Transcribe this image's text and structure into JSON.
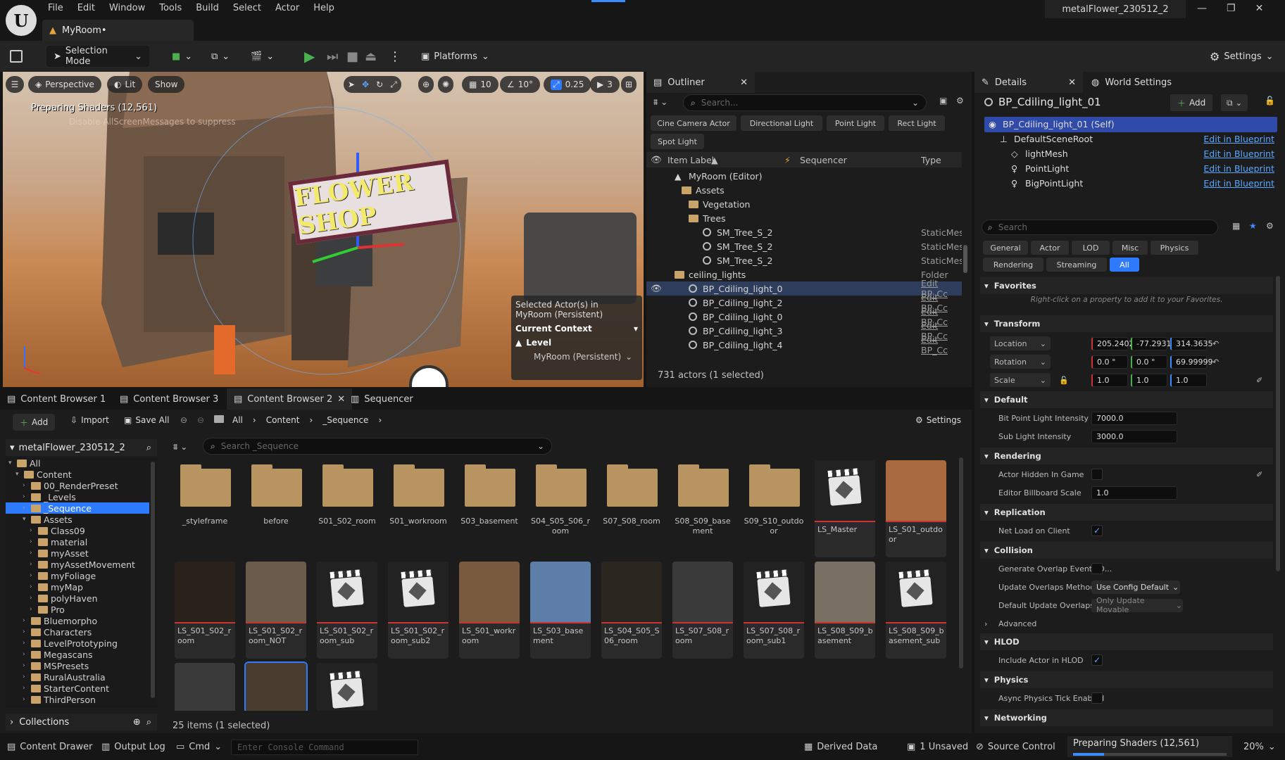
{
  "app": {
    "logo": "U",
    "project_title": "metalFlower_230512_2",
    "level_tab": "MyRoom•"
  },
  "menu": [
    "File",
    "Edit",
    "Window",
    "Tools",
    "Build",
    "Select",
    "Actor",
    "Help"
  ],
  "toolbar": {
    "selection_mode": "Selection Mode",
    "platforms": "Platforms",
    "settings": "Settings"
  },
  "viewport": {
    "perspective": "Perspective",
    "lit": "Lit",
    "show": "Show",
    "grid_value": "10",
    "angle_value": "10°",
    "scale_value": "0.25",
    "camera_speed": "3",
    "shader_msg": "Preparing Shaders (12,561)",
    "shader_sub": "Disable AllScreenMessages to suppress",
    "selected_label": "Selected Actor(s) in",
    "selected_level": "MyRoom (Persistent)",
    "current_context": "Current Context",
    "level_label": "Level",
    "level_value": "MyRoom (Persistent)",
    "sign_text": "FLOWER SHOP"
  },
  "outliner": {
    "tab": "Outliner",
    "search_placeholder": "Search...",
    "chips": [
      "Cine Camera Actor",
      "Directional Light",
      "Point Light",
      "Rect Light",
      "Spot Light"
    ],
    "col_label": "Item Label",
    "col_seq": "Sequencer",
    "col_type": "Type",
    "rows": [
      {
        "label": "MyRoom (Editor)",
        "type": ""
      },
      {
        "label": "Assets",
        "type": ""
      },
      {
        "label": "Vegetation",
        "type": ""
      },
      {
        "label": "Trees",
        "type": ""
      },
      {
        "label": "SM_Tree_S_2",
        "type": "StaticMes"
      },
      {
        "label": "SM_Tree_S_2",
        "type": "StaticMes"
      },
      {
        "label": "SM_Tree_S_2",
        "type": "StaticMes"
      },
      {
        "label": "ceiling_lights",
        "type": "Folder"
      },
      {
        "label": "BP_Cdiling_light_0",
        "type": "Edit BP_Cc"
      },
      {
        "label": "BP_Cdiling_light_2",
        "type": "Edit BP_Cc"
      },
      {
        "label": "BP_Cdiling_light_0",
        "type": "Edit BP_Cc"
      },
      {
        "label": "BP_Cdiling_light_3",
        "type": "Edit BP_Cc"
      },
      {
        "label": "BP_Cdiling_light_4",
        "type": "Edit BP_Cc"
      }
    ],
    "count": "731 actors (1 selected)"
  },
  "details": {
    "tab_details": "Details",
    "tab_world": "World Settings",
    "actor_name": "BP_Cdiling_light_01",
    "add": "Add",
    "components": [
      {
        "label": "BP_Cdiling_light_01 (Self)",
        "link": ""
      },
      {
        "label": "DefaultSceneRoot",
        "link": "Edit in Blueprint"
      },
      {
        "label": "lightMesh",
        "link": "Edit in Blueprint"
      },
      {
        "label": "PointLight",
        "link": "Edit in Blueprint"
      },
      {
        "label": "BigPointLight",
        "link": "Edit in Blueprint"
      }
    ],
    "search_placeholder": "Search",
    "filters": [
      "General",
      "Actor",
      "LOD",
      "Misc",
      "Physics",
      "Rendering",
      "Streaming",
      "All"
    ],
    "favorites": "Favorites",
    "favorites_hint": "Right-click on a property to add it to your Favorites.",
    "transform": "Transform",
    "location": "Location",
    "loc": [
      "205.2402",
      "-77.2931",
      "314.3635"
    ],
    "rotation": "Rotation",
    "rot": [
      "0.0 °",
      "0.0 °",
      "69.99999"
    ],
    "scale": "Scale",
    "scl": [
      "1.0",
      "1.0",
      "1.0"
    ],
    "default_cat": "Default",
    "bit_point_label": "Bit Point Light Intensity",
    "bit_point_value": "7000.0",
    "sub_light_label": "Sub Light Intensity",
    "sub_light_value": "3000.0",
    "rendering_cat": "Rendering",
    "actor_hidden": "Actor Hidden In Game",
    "billboard_label": "Editor Billboard Scale",
    "billboard_value": "1.0",
    "replication_cat": "Replication",
    "net_load": "Net Load on Client",
    "collision_cat": "Collision",
    "gen_overlap": "Generate Overlap Events D...",
    "update_overlap": "Update Overlaps Method D...",
    "update_overlap_value": "Use Config Default",
    "default_update": "Default Update Overlaps M...",
    "default_update_value": "Only Update Movable",
    "advanced": "Advanced",
    "hlod_cat": "HLOD",
    "include_hlod": "Include Actor in HLOD",
    "physics_cat": "Physics",
    "async_physics": "Async Physics Tick Enabled",
    "networking_cat": "Networking"
  },
  "content_browser": {
    "tabs": [
      "Content Browser 1",
      "Content Browser 3",
      "Content Browser 2",
      "Sequencer"
    ],
    "add": "Add",
    "import": "Import",
    "save_all": "Save All",
    "crumbs": [
      "All",
      "Content",
      "_Sequence"
    ],
    "settings": "Settings",
    "root": "metalFlower_230512_2",
    "search_placeholder": "Search _Sequence",
    "tree": [
      {
        "label": "All",
        "indent": 0
      },
      {
        "label": "Content",
        "indent": 1
      },
      {
        "label": "00_RenderPreset",
        "indent": 2
      },
      {
        "label": "_Levels",
        "indent": 2
      },
      {
        "label": "_Sequence",
        "indent": 2
      },
      {
        "label": "Assets",
        "indent": 2
      },
      {
        "label": "Class09",
        "indent": 3
      },
      {
        "label": "material",
        "indent": 3
      },
      {
        "label": "myAsset",
        "indent": 3
      },
      {
        "label": "myAssetMovement",
        "indent": 3
      },
      {
        "label": "myFoliage",
        "indent": 3
      },
      {
        "label": "myMap",
        "indent": 3
      },
      {
        "label": "polyHaven",
        "indent": 3
      },
      {
        "label": "Pro",
        "indent": 3
      },
      {
        "label": "Bluemorpho",
        "indent": 2
      },
      {
        "label": "Characters",
        "indent": 2
      },
      {
        "label": "LevelPrototyping",
        "indent": 2
      },
      {
        "label": "Megascans",
        "indent": 2
      },
      {
        "label": "MSPresets",
        "indent": 2
      },
      {
        "label": "RuralAustralia",
        "indent": 2
      },
      {
        "label": "StarterContent",
        "indent": 2
      },
      {
        "label": "ThirdPerson",
        "indent": 2
      }
    ],
    "collections": "Collections",
    "folders": [
      "_styleframe",
      "before",
      "S01_S02_room",
      "S01_workroom",
      "S03_basement",
      "S04_S05_S06_room",
      "S07_S08_room",
      "S08_S09_basement",
      "S09_S10_outdoor"
    ],
    "assets_row1": [
      "LS_Master",
      "LS_S01_outdoor"
    ],
    "assets_row2": [
      "LS_S01_S02_room",
      "LS_S01_S02_room_NOT",
      "LS_S01_S02_room_sub",
      "LS_S01_S02_room_sub2",
      "LS_S01_workroom",
      "LS_S03_basement",
      "LS_S04_S05_S06_room",
      "LS_S07_S08_room",
      "LS_S07_S08_room_sub1",
      "LS_S08_S09_basement",
      "LS_S08_S09_basement_sub"
    ],
    "item_count": "25 items (1 selected)"
  },
  "status": {
    "content_drawer": "Content Drawer",
    "output_log": "Output Log",
    "cmd": "Cmd",
    "console_placeholder": "Enter Console Command",
    "derived_data": "Derived Data",
    "unsaved": "1 Unsaved",
    "source_control": "Source Control",
    "shaders": "Preparing Shaders (12,561)",
    "percent": "20%",
    "progress": 0.2
  }
}
